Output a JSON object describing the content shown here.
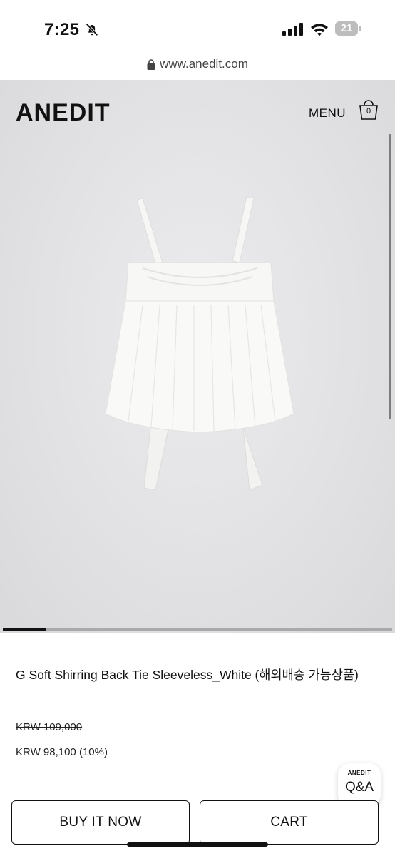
{
  "status_bar": {
    "time": "7:25",
    "battery": "21"
  },
  "browser": {
    "url": "www.anedit.com"
  },
  "header": {
    "brand": "ANEDIT",
    "menu_label": "MENU",
    "cart_count": "0"
  },
  "gallery": {
    "progress": 0.11
  },
  "product": {
    "name": "G Soft Shirring Back Tie Sleeveless_White (해외배송 가능상품)",
    "original_price": "KRW 109,000",
    "sale_price": "KRW 98,100 (10%)"
  },
  "qa_widget": {
    "brand": "ANEDIT",
    "label": "Q&A"
  },
  "actions": {
    "buy_now": "BUY IT NOW",
    "cart": "CART"
  },
  "colors": {
    "text": "#111111",
    "hero_background": "#e3e3e5"
  }
}
